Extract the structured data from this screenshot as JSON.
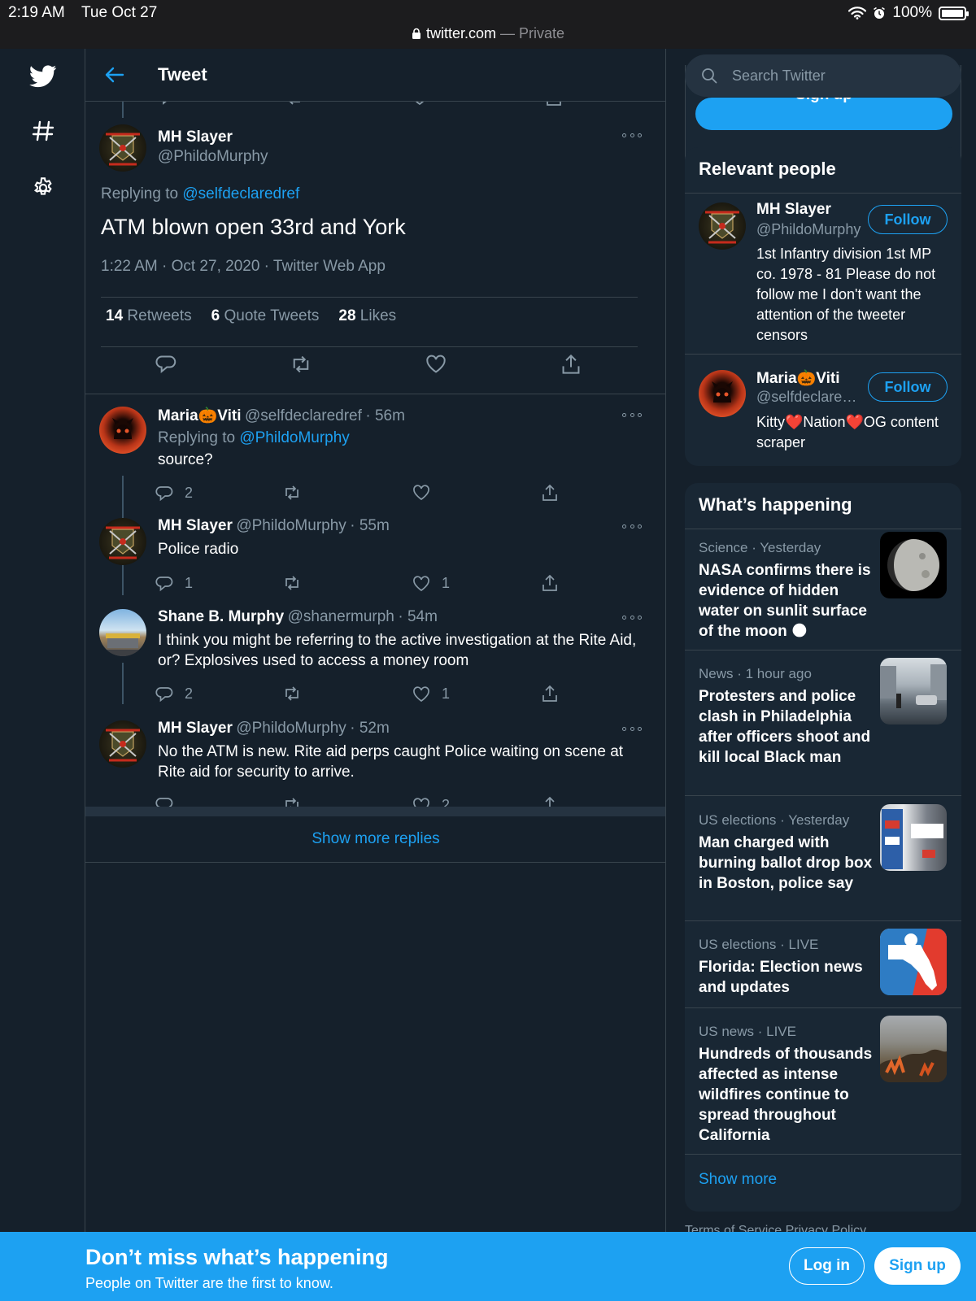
{
  "status_bar": {
    "time": "2:19 AM",
    "date": "Tue Oct 27",
    "domain": "twitter.com",
    "separator": " — ",
    "mode": "Private",
    "battery": "100%"
  },
  "header": {
    "title": "Tweet"
  },
  "focused_tweet": {
    "name": "MH Slayer",
    "handle": "@PhildoMurphy",
    "replying_prefix": "Replying to ",
    "replying_to": "@selfdeclaredref",
    "text": "ATM blown open 33rd and York",
    "meta": "1:22 AM · Oct 27, 2020 · Twitter Web App",
    "stats": [
      {
        "count": "14",
        "label": "Retweets"
      },
      {
        "count": "6",
        "label": "Quote Tweets"
      },
      {
        "count": "28",
        "label": "Likes"
      }
    ]
  },
  "replies": [
    {
      "name": "Maria🎃Viti",
      "handle": "@selfdeclaredref",
      "time": "· 56m",
      "replying_prefix": "Replying to ",
      "replying_to": "@PhildoMurphy",
      "text": "source?",
      "reply_count": "2",
      "like_count": ""
    },
    {
      "name": "MH Slayer",
      "handle": "@PhildoMurphy",
      "time": "· 55m",
      "text": "Police radio",
      "reply_count": "1",
      "like_count": "1"
    },
    {
      "name": "Shane B. Murphy",
      "handle": "@shanermurph",
      "time": "· 54m",
      "text": "I think you might be referring to the active investigation at the Rite Aid, or? Explosives used to access a money room",
      "reply_count": "2",
      "like_count": "1"
    },
    {
      "name": "MH Slayer",
      "handle": "@PhildoMurphy",
      "time": "· 52m",
      "text": "No the ATM is new. Rite aid perps caught Police waiting on scene at Rite aid for security to arrive.",
      "reply_count": "",
      "like_count": "2"
    }
  ],
  "show_more_replies": "Show more replies",
  "sidebar": {
    "search_placeholder": "Search Twitter",
    "signup_peek": "Sign up",
    "relevant_people": {
      "title": "Relevant people",
      "people": [
        {
          "name": "MH Slayer",
          "handle": "@PhildoMurphy",
          "follow": "Follow",
          "bio": "1st Infantry division 1st MP co. 1978 - 81 Please do not follow me I don't want the attention of the tweeter censors"
        },
        {
          "name": "Maria🎃Viti",
          "handle": "@selfdeclaredref",
          "follow": "Follow",
          "bio": "Kitty❤️Nation❤️OG content scraper"
        }
      ]
    },
    "whats_happening": {
      "title": "What’s happening",
      "trends": [
        {
          "meta": "Science · Yesterday",
          "title": "NASA confirms there is evidence of hidden water on sunlit surface of the moon 🌑",
          "image": "moon-image"
        },
        {
          "meta": "News · 1 hour ago",
          "title": "Protesters and police clash in Philadelphia after officers shoot and kill local Black man",
          "image": "street-image"
        },
        {
          "meta": "US elections · Yesterday",
          "title": "Man charged with burning ballot drop box in Boston, police say",
          "image": "ballot-dropbox-image"
        },
        {
          "meta": "US elections · LIVE",
          "title": "Florida: Election news and updates",
          "image": "florida-map-image"
        },
        {
          "meta": "US news · LIVE",
          "title": "Hundreds of thousands affected as intense wildfires continue to spread throughout California",
          "image": "wildfire-image"
        }
      ],
      "show_more": "Show more"
    },
    "terms": "Terms of Service  Privacy Policy"
  },
  "banner": {
    "title": "Don’t miss what’s happening",
    "subtitle": "People on Twitter are the first to know.",
    "login": "Log in",
    "signup": "Sign up"
  },
  "colors": {
    "background": "#15202b",
    "card": "#192734",
    "accent": "#1da1f2",
    "border": "#38444d",
    "muted": "#8899a6"
  }
}
